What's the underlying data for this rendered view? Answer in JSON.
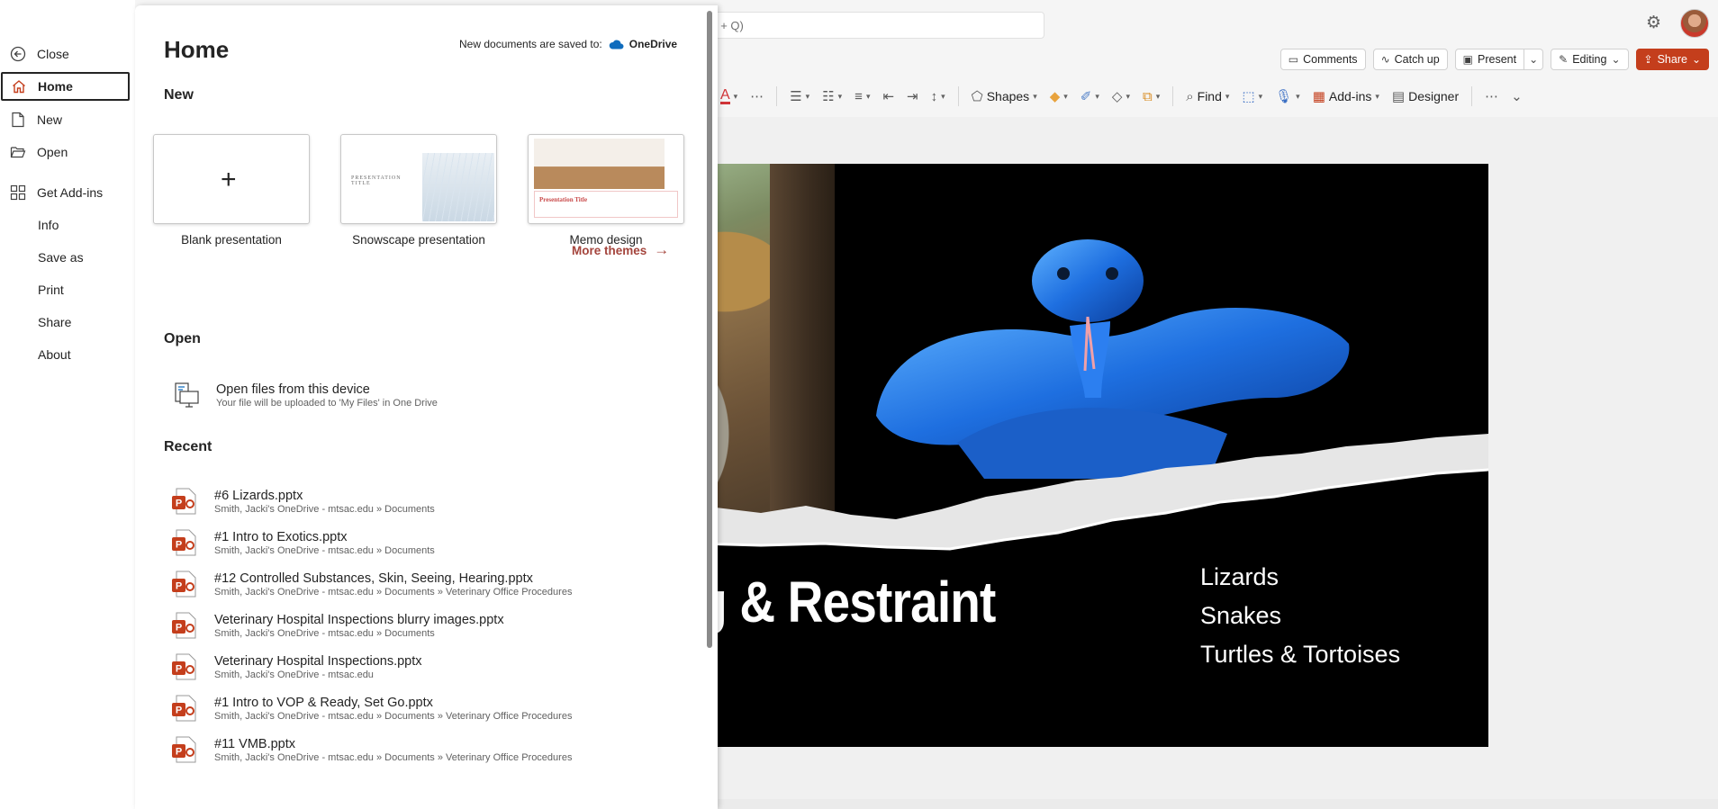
{
  "app": {
    "search_placeholder": "t + Q)",
    "command_bar": {
      "comments": "Comments",
      "catch_up": "Catch up",
      "present": "Present",
      "editing": "Editing",
      "share": "Share"
    },
    "ribbon": {
      "shapes": "Shapes",
      "find": "Find",
      "add_ins": "Add-ins",
      "designer": "Designer"
    }
  },
  "slide": {
    "title": "ndling & Restraint",
    "list": [
      "Lizards",
      "Snakes",
      "Turtles & Tortoises"
    ]
  },
  "nav": {
    "items": [
      {
        "label": "Close",
        "icon": "back-circle-icon"
      },
      {
        "label": "Home",
        "icon": "home-icon",
        "active": true
      },
      {
        "label": "New",
        "icon": "new-document-icon"
      },
      {
        "label": "Open",
        "icon": "folder-open-icon"
      },
      {
        "label": "Get Add-ins",
        "icon": "apps-grid-icon"
      },
      {
        "label": "Info"
      },
      {
        "label": "Save as"
      },
      {
        "label": "Print"
      },
      {
        "label": "Share"
      },
      {
        "label": "About"
      }
    ]
  },
  "home": {
    "title": "Home",
    "save_note_prefix": "New documents are saved to:",
    "save_location": "OneDrive",
    "new_heading": "New",
    "templates": [
      {
        "label": "Blank presentation"
      },
      {
        "label": "Snowscape presentation",
        "thumb_text": "PRESENTATION TITLE"
      },
      {
        "label": "Memo design",
        "thumb_text": "Presentation Title"
      }
    ],
    "more_themes": "More themes",
    "open_heading": "Open",
    "open_device": {
      "title": "Open files from this device",
      "subtitle": "Your file will be uploaded to 'My Files' in One Drive"
    },
    "recent_heading": "Recent",
    "recent": [
      {
        "name": "#6 Lizards.pptx",
        "path": "Smith, Jacki's OneDrive - mtsac.edu » Documents"
      },
      {
        "name": "#1 Intro to Exotics.pptx",
        "path": "Smith, Jacki's OneDrive - mtsac.edu » Documents"
      },
      {
        "name": "#12 Controlled Substances, Skin, Seeing, Hearing.pptx",
        "path": "Smith, Jacki's OneDrive - mtsac.edu » Documents » Veterinary Office Procedures"
      },
      {
        "name": "Veterinary Hospital Inspections blurry images.pptx",
        "path": "Smith, Jacki's OneDrive - mtsac.edu » Documents"
      },
      {
        "name": "Veterinary Hospital Inspections.pptx",
        "path": "Smith, Jacki's OneDrive - mtsac.edu"
      },
      {
        "name": "#1 Intro to VOP & Ready, Set Go.pptx",
        "path": "Smith, Jacki's OneDrive - mtsac.edu » Documents » Veterinary Office Procedures"
      },
      {
        "name": "#11 VMB.pptx",
        "path": "Smith, Jacki's OneDrive - mtsac.edu » Documents » Veterinary Office Procedures"
      }
    ]
  },
  "colors": {
    "accent": "#c43e1c",
    "more_themes": "#a4443c",
    "ppt_icon": "#c43e1c",
    "onedrive": "#0f6cbd"
  }
}
